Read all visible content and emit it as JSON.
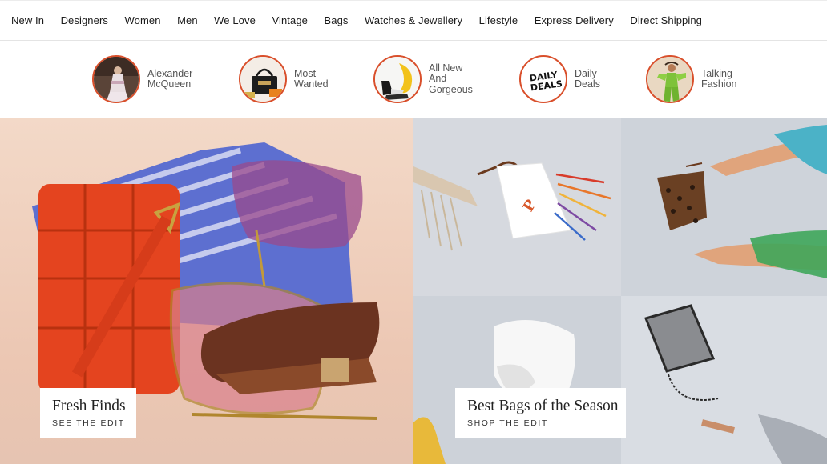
{
  "nav": {
    "items": [
      "New In",
      "Designers",
      "Women",
      "Men",
      "We Love",
      "Vintage",
      "Bags",
      "Watches & Jewellery",
      "Lifestyle",
      "Express Delivery",
      "Direct Shipping"
    ]
  },
  "circles": [
    {
      "lines": [
        "Alexander",
        "McQueen"
      ],
      "icon": "runway-model-image"
    },
    {
      "lines": [
        "Most",
        "Wanted"
      ],
      "icon": "handbag-image"
    },
    {
      "lines": [
        "All New",
        "And",
        "Gorgeous"
      ],
      "icon": "shoes-image"
    },
    {
      "lines": [
        "Daily",
        "Deals"
      ],
      "icon": "daily-deals-logo",
      "logo_text": [
        "DAILY",
        "DEALS"
      ]
    },
    {
      "lines": [
        "Talking",
        "Fashion"
      ],
      "icon": "green-outfit-image"
    }
  ],
  "hero": {
    "left": {
      "title": "Fresh Finds",
      "link": "SEE THE EDIT"
    },
    "right": {
      "title": "Best Bags of the Season",
      "link": "SHOP THE EDIT"
    }
  },
  "colors": {
    "accent_ring": "#d94f2b",
    "text": "#222222",
    "nav_border": "#e4e4e4"
  }
}
